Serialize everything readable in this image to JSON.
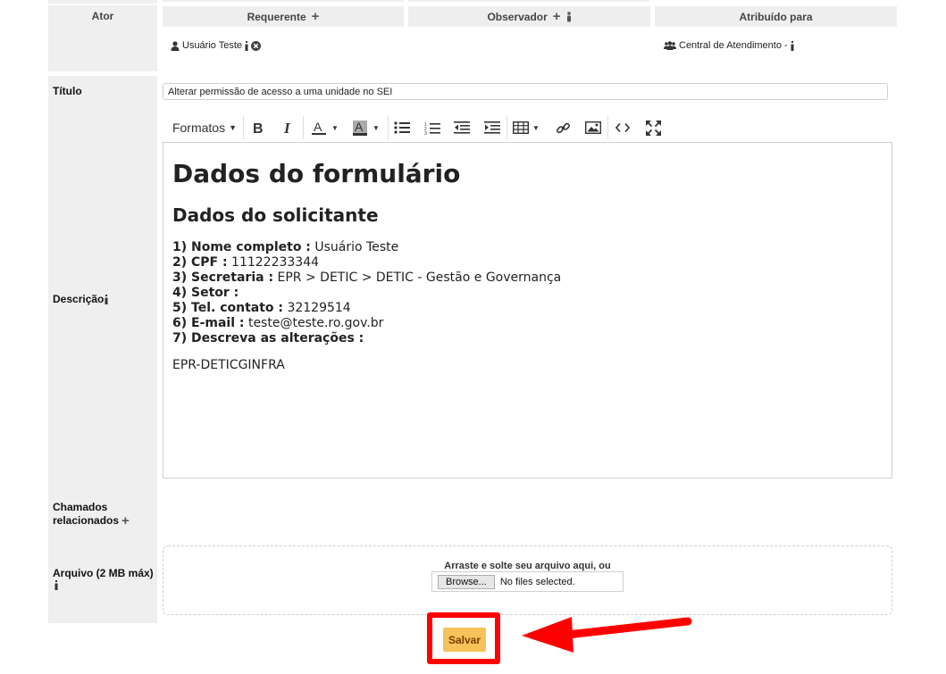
{
  "actors": {
    "label": "Ator",
    "requester": {
      "header": "Requerente",
      "name": "Usuário Teste"
    },
    "observer": {
      "header": "Observador"
    },
    "assigned": {
      "header": "Atribuído para",
      "name": "Central de Atendimento -"
    }
  },
  "title_field": {
    "label": "Título",
    "value": "Alterar permissão de acesso a uma unidade no SEI"
  },
  "description": {
    "label": "Descrição",
    "toolbar": {
      "formats": "Formatos"
    },
    "content": {
      "h1": "Dados do formulário",
      "h2": "Dados do solicitante",
      "fields": [
        {
          "key": "1) Nome completo :",
          "value": "Usuário Teste"
        },
        {
          "key": "2) CPF :",
          "value": "11122233344"
        },
        {
          "key": "3) Secretaria :",
          "value": "EPR > DETIC > DETIC - Gestão e Governança"
        },
        {
          "key": "4) Setor :",
          "value": ""
        },
        {
          "key": "5) Tel. contato :",
          "value": "32129514"
        },
        {
          "key": "6) E-mail :",
          "value": "teste@teste.ro.gov.br"
        },
        {
          "key": "7) Descreva as alterações :",
          "value": ""
        }
      ],
      "footer": "EPR-DETICGINFRA"
    }
  },
  "related": {
    "label_line1": "Chamados",
    "label_line2": "relacionados"
  },
  "attachment": {
    "label": "Arquivo (2 MB máx)",
    "drop_text": "Arraste e solte seu arquivo aqui, ou",
    "browse_label": "Browse...",
    "no_file": "No files selected."
  },
  "actions": {
    "save_label": "Salvar"
  },
  "colors": {
    "save_button": "#f5c35a",
    "highlight": "#ff0000",
    "label_bg": "#efefef"
  }
}
